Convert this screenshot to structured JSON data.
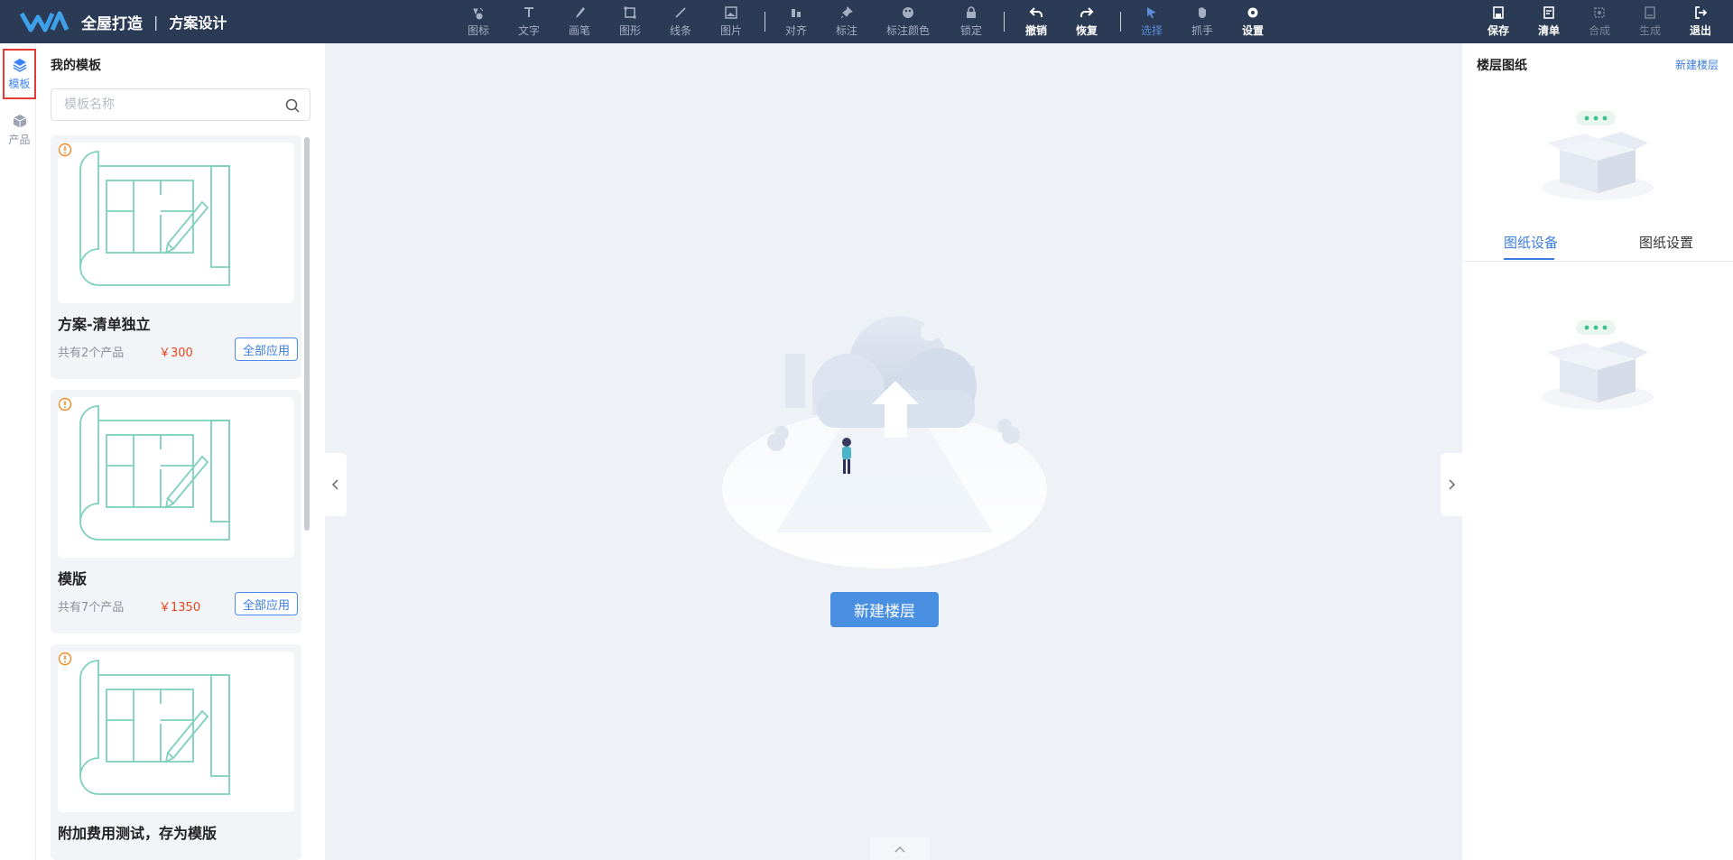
{
  "header": {
    "brand_title": "全屋打造",
    "separator": "|",
    "brand_sub": "方案设计",
    "tools": [
      {
        "label": "图标",
        "icon": "icon-tool-icon"
      },
      {
        "label": "文字",
        "icon": "text-icon"
      },
      {
        "label": "画笔",
        "icon": "brush-icon"
      },
      {
        "label": "图形",
        "icon": "shape-icon"
      },
      {
        "label": "线条",
        "icon": "line-icon"
      },
      {
        "label": "图片",
        "icon": "image-icon"
      },
      {
        "label": "对齐",
        "icon": "align-icon"
      },
      {
        "label": "标注",
        "icon": "pin-icon"
      },
      {
        "label": "标注颜色",
        "icon": "palette-icon"
      },
      {
        "label": "锁定",
        "icon": "lock-icon"
      },
      {
        "label": "撤销",
        "icon": "undo-icon"
      },
      {
        "label": "恢复",
        "icon": "redo-icon"
      },
      {
        "label": "选择",
        "icon": "cursor-icon"
      },
      {
        "label": "抓手",
        "icon": "hand-icon"
      },
      {
        "label": "设置",
        "icon": "gear-icon"
      }
    ],
    "actions": [
      {
        "label": "保存",
        "icon": "save-icon"
      },
      {
        "label": "清单",
        "icon": "list-icon"
      },
      {
        "label": "合成",
        "icon": "compose-icon"
      },
      {
        "label": "生成",
        "icon": "generate-icon"
      },
      {
        "label": "退出",
        "icon": "logout-icon"
      }
    ],
    "colors": {
      "bar": "#2b3a55",
      "active_tool": "#5b8dd8"
    }
  },
  "rail": {
    "items": [
      {
        "label": "模板",
        "icon": "layers-icon",
        "active": true
      },
      {
        "label": "产品",
        "icon": "cube-icon",
        "active": false
      }
    ]
  },
  "templates": {
    "title": "我的模板",
    "search_placeholder": "模板名称",
    "cards": [
      {
        "name": "方案-清单独立",
        "count": "共有2个产品",
        "price": "￥300",
        "apply": "全部应用"
      },
      {
        "name": "模版",
        "count": "共有7个产品",
        "price": "￥1350",
        "apply": "全部应用"
      },
      {
        "name": "附加费用测试，存为模版",
        "count": "",
        "price": "",
        "apply": ""
      }
    ]
  },
  "canvas": {
    "new_floor_button": "新建楼层"
  },
  "right_panel": {
    "title": "楼层图纸",
    "new_floor_link": "新建楼层",
    "tabs": [
      {
        "label": "图纸设备",
        "active": true
      },
      {
        "label": "图纸设置",
        "active": false
      }
    ]
  }
}
